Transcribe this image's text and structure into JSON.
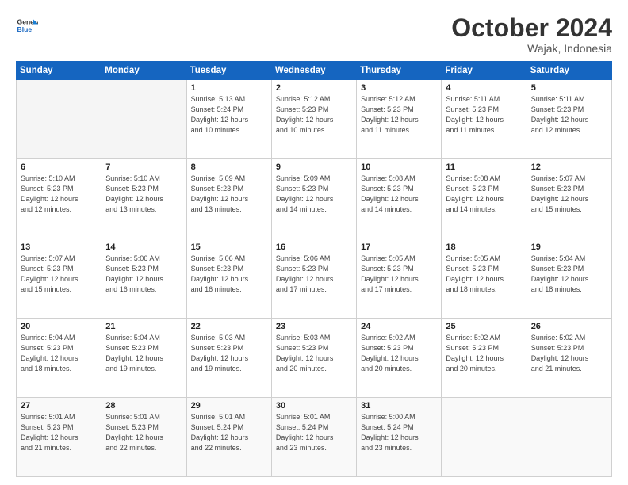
{
  "header": {
    "logo_general": "General",
    "logo_blue": "Blue",
    "month_title": "October 2024",
    "location": "Wajak, Indonesia"
  },
  "weekdays": [
    "Sunday",
    "Monday",
    "Tuesday",
    "Wednesday",
    "Thursday",
    "Friday",
    "Saturday"
  ],
  "weeks": [
    [
      {
        "day": "",
        "sunrise": "",
        "sunset": "",
        "daylight": ""
      },
      {
        "day": "",
        "sunrise": "",
        "sunset": "",
        "daylight": ""
      },
      {
        "day": "1",
        "sunrise": "Sunrise: 5:13 AM",
        "sunset": "Sunset: 5:24 PM",
        "daylight": "Daylight: 12 hours and 10 minutes."
      },
      {
        "day": "2",
        "sunrise": "Sunrise: 5:12 AM",
        "sunset": "Sunset: 5:23 PM",
        "daylight": "Daylight: 12 hours and 10 minutes."
      },
      {
        "day": "3",
        "sunrise": "Sunrise: 5:12 AM",
        "sunset": "Sunset: 5:23 PM",
        "daylight": "Daylight: 12 hours and 11 minutes."
      },
      {
        "day": "4",
        "sunrise": "Sunrise: 5:11 AM",
        "sunset": "Sunset: 5:23 PM",
        "daylight": "Daylight: 12 hours and 11 minutes."
      },
      {
        "day": "5",
        "sunrise": "Sunrise: 5:11 AM",
        "sunset": "Sunset: 5:23 PM",
        "daylight": "Daylight: 12 hours and 12 minutes."
      }
    ],
    [
      {
        "day": "6",
        "sunrise": "Sunrise: 5:10 AM",
        "sunset": "Sunset: 5:23 PM",
        "daylight": "Daylight: 12 hours and 12 minutes."
      },
      {
        "day": "7",
        "sunrise": "Sunrise: 5:10 AM",
        "sunset": "Sunset: 5:23 PM",
        "daylight": "Daylight: 12 hours and 13 minutes."
      },
      {
        "day": "8",
        "sunrise": "Sunrise: 5:09 AM",
        "sunset": "Sunset: 5:23 PM",
        "daylight": "Daylight: 12 hours and 13 minutes."
      },
      {
        "day": "9",
        "sunrise": "Sunrise: 5:09 AM",
        "sunset": "Sunset: 5:23 PM",
        "daylight": "Daylight: 12 hours and 14 minutes."
      },
      {
        "day": "10",
        "sunrise": "Sunrise: 5:08 AM",
        "sunset": "Sunset: 5:23 PM",
        "daylight": "Daylight: 12 hours and 14 minutes."
      },
      {
        "day": "11",
        "sunrise": "Sunrise: 5:08 AM",
        "sunset": "Sunset: 5:23 PM",
        "daylight": "Daylight: 12 hours and 14 minutes."
      },
      {
        "day": "12",
        "sunrise": "Sunrise: 5:07 AM",
        "sunset": "Sunset: 5:23 PM",
        "daylight": "Daylight: 12 hours and 15 minutes."
      }
    ],
    [
      {
        "day": "13",
        "sunrise": "Sunrise: 5:07 AM",
        "sunset": "Sunset: 5:23 PM",
        "daylight": "Daylight: 12 hours and 15 minutes."
      },
      {
        "day": "14",
        "sunrise": "Sunrise: 5:06 AM",
        "sunset": "Sunset: 5:23 PM",
        "daylight": "Daylight: 12 hours and 16 minutes."
      },
      {
        "day": "15",
        "sunrise": "Sunrise: 5:06 AM",
        "sunset": "Sunset: 5:23 PM",
        "daylight": "Daylight: 12 hours and 16 minutes."
      },
      {
        "day": "16",
        "sunrise": "Sunrise: 5:06 AM",
        "sunset": "Sunset: 5:23 PM",
        "daylight": "Daylight: 12 hours and 17 minutes."
      },
      {
        "day": "17",
        "sunrise": "Sunrise: 5:05 AM",
        "sunset": "Sunset: 5:23 PM",
        "daylight": "Daylight: 12 hours and 17 minutes."
      },
      {
        "day": "18",
        "sunrise": "Sunrise: 5:05 AM",
        "sunset": "Sunset: 5:23 PM",
        "daylight": "Daylight: 12 hours and 18 minutes."
      },
      {
        "day": "19",
        "sunrise": "Sunrise: 5:04 AM",
        "sunset": "Sunset: 5:23 PM",
        "daylight": "Daylight: 12 hours and 18 minutes."
      }
    ],
    [
      {
        "day": "20",
        "sunrise": "Sunrise: 5:04 AM",
        "sunset": "Sunset: 5:23 PM",
        "daylight": "Daylight: 12 hours and 18 minutes."
      },
      {
        "day": "21",
        "sunrise": "Sunrise: 5:04 AM",
        "sunset": "Sunset: 5:23 PM",
        "daylight": "Daylight: 12 hours and 19 minutes."
      },
      {
        "day": "22",
        "sunrise": "Sunrise: 5:03 AM",
        "sunset": "Sunset: 5:23 PM",
        "daylight": "Daylight: 12 hours and 19 minutes."
      },
      {
        "day": "23",
        "sunrise": "Sunrise: 5:03 AM",
        "sunset": "Sunset: 5:23 PM",
        "daylight": "Daylight: 12 hours and 20 minutes."
      },
      {
        "day": "24",
        "sunrise": "Sunrise: 5:02 AM",
        "sunset": "Sunset: 5:23 PM",
        "daylight": "Daylight: 12 hours and 20 minutes."
      },
      {
        "day": "25",
        "sunrise": "Sunrise: 5:02 AM",
        "sunset": "Sunset: 5:23 PM",
        "daylight": "Daylight: 12 hours and 20 minutes."
      },
      {
        "day": "26",
        "sunrise": "Sunrise: 5:02 AM",
        "sunset": "Sunset: 5:23 PM",
        "daylight": "Daylight: 12 hours and 21 minutes."
      }
    ],
    [
      {
        "day": "27",
        "sunrise": "Sunrise: 5:01 AM",
        "sunset": "Sunset: 5:23 PM",
        "daylight": "Daylight: 12 hours and 21 minutes."
      },
      {
        "day": "28",
        "sunrise": "Sunrise: 5:01 AM",
        "sunset": "Sunset: 5:23 PM",
        "daylight": "Daylight: 12 hours and 22 minutes."
      },
      {
        "day": "29",
        "sunrise": "Sunrise: 5:01 AM",
        "sunset": "Sunset: 5:24 PM",
        "daylight": "Daylight: 12 hours and 22 minutes."
      },
      {
        "day": "30",
        "sunrise": "Sunrise: 5:01 AM",
        "sunset": "Sunset: 5:24 PM",
        "daylight": "Daylight: 12 hours and 23 minutes."
      },
      {
        "day": "31",
        "sunrise": "Sunrise: 5:00 AM",
        "sunset": "Sunset: 5:24 PM",
        "daylight": "Daylight: 12 hours and 23 minutes."
      },
      {
        "day": "",
        "sunrise": "",
        "sunset": "",
        "daylight": ""
      },
      {
        "day": "",
        "sunrise": "",
        "sunset": "",
        "daylight": ""
      }
    ]
  ]
}
